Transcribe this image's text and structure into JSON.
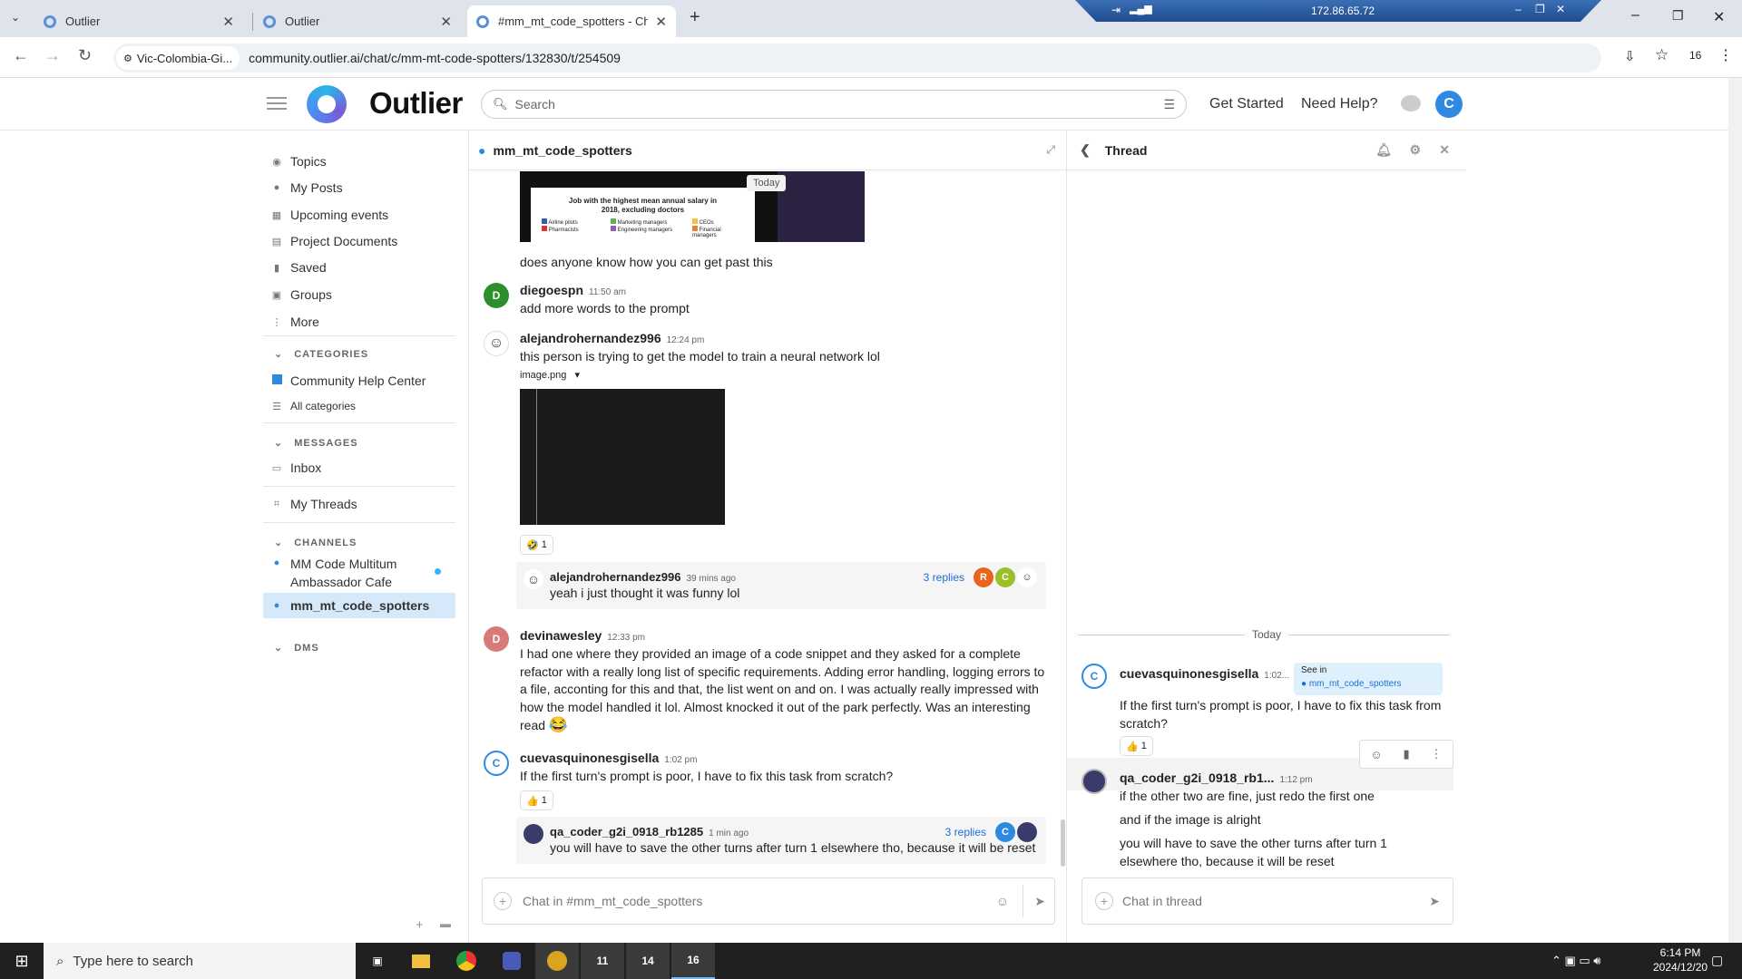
{
  "browser": {
    "tabs": [
      {
        "title": "Outlier"
      },
      {
        "title": "Outlier"
      },
      {
        "title": "#mm_mt_code_spotters - Chat"
      }
    ],
    "site_chip": "Vic-Colombia-Gi...",
    "url": "community.outlier.ai/chat/c/mm-mt-code-spotters/132830/t/254509",
    "remote_ip": "172.86.65.72",
    "profile_count": "16"
  },
  "header": {
    "logo": "Outlier",
    "search_placeholder": "Search",
    "get_started": "Get Started",
    "need_help": "Need Help?",
    "user_initial": "C"
  },
  "sidebar": {
    "items": [
      {
        "label": "Topics"
      },
      {
        "label": "My Posts"
      },
      {
        "label": "Upcoming events"
      },
      {
        "label": "Project Documents"
      },
      {
        "label": "Saved"
      },
      {
        "label": "Groups"
      },
      {
        "label": "More"
      }
    ],
    "categories_header": "CATEGORIES",
    "categories": [
      {
        "label": "Community Help Center"
      },
      {
        "label": "All categories"
      }
    ],
    "messages_header": "MESSAGES",
    "inbox": "Inbox",
    "my_threads": "My Threads",
    "channels_header": "CHANNELS",
    "channels": [
      {
        "label": "MM Code Multitum Ambassador Cafe"
      },
      {
        "label": "mm_mt_code_spotters"
      }
    ],
    "dms_header": "DMS"
  },
  "chat": {
    "channel": "mm_mt_code_spotters",
    "today_chip": "Today",
    "embed_title": "Job with the highest mean annual salary in 2018, excluding doctors",
    "embed_legend": [
      "Airline pilots",
      "Marketing managers",
      "CEOs",
      "Pharmacists",
      "Engineering managers",
      "Financial managers"
    ],
    "embed_legend_colors": [
      "#2f5fb3",
      "#5fb34c",
      "#f0c040",
      "#d33",
      "#9b59b6",
      "#f08030"
    ],
    "msg0_text": "does anyone know how you can get past this",
    "m1": {
      "user": "diegoespn",
      "time": "11:50 am",
      "initial": "D",
      "text": "add more words to the prompt"
    },
    "m2": {
      "user": "alejandrohernandez996",
      "time": "12:24 pm",
      "text": "this person is trying to get the model to train a neural network lol",
      "attachment": "image.png",
      "reaction": "🤣",
      "reaction_count": "1",
      "reply": {
        "user": "alejandrohernandez996",
        "time": "39 mins ago",
        "text": "yeah i just thought it was funny lol",
        "replies": "3 replies"
      }
    },
    "m3": {
      "user": "devinawesley",
      "time": "12:33 pm",
      "initial": "D",
      "text": "I had one where they provided an image of a code snippet and they asked for a complete refactor with a really long list of specific requirements. Adding error handling, logging errors to a file, acconting for this and that, the list went on and on. I was actually really impressed with how the model handled it lol. Almost knocked it out of the park perfectly. Was an interesting read",
      "emoji": "😂"
    },
    "m4": {
      "user": "cuevasquinonesgisella",
      "time": "1:02 pm",
      "initial": "C",
      "text": "If the first turn's prompt is poor, I have to fix this task from scratch?",
      "reaction": "👍",
      "reaction_count": "1",
      "reply": {
        "user": "qa_coder_g2i_0918_rb1285",
        "time": "1 min ago",
        "text": "you will have to save the other turns after turn 1 elsewhere tho, because it will be reset",
        "replies": "3 replies"
      }
    },
    "participants": [
      "R",
      "C"
    ],
    "composer_placeholder": "Chat in #mm_mt_code_spotters"
  },
  "thread": {
    "title": "Thread",
    "today": "Today",
    "op": {
      "user": "cuevasquinonesgisella",
      "time": "1:02...",
      "initial": "C",
      "see_in": "See in",
      "see_in_channel": "mm_mt_code_spotters",
      "text": "If the first turn's prompt is poor, I have to fix this task from scratch?",
      "reaction": "👍",
      "reaction_count": "1"
    },
    "reply": {
      "user": "qa_coder_g2i_0918_rb1...",
      "time": "1:12 pm",
      "lines": [
        "if the other two are fine, just redo the first one",
        "and if the image is alright",
        "you will have to save the other turns after turn 1 elsewhere tho, because it will be reset"
      ]
    },
    "composer_placeholder": "Chat in thread"
  },
  "taskbar": {
    "search_placeholder": "Type here to search",
    "time": "6:14 PM",
    "date": "2024/12/20",
    "badges": [
      "11",
      "14",
      "16"
    ]
  }
}
